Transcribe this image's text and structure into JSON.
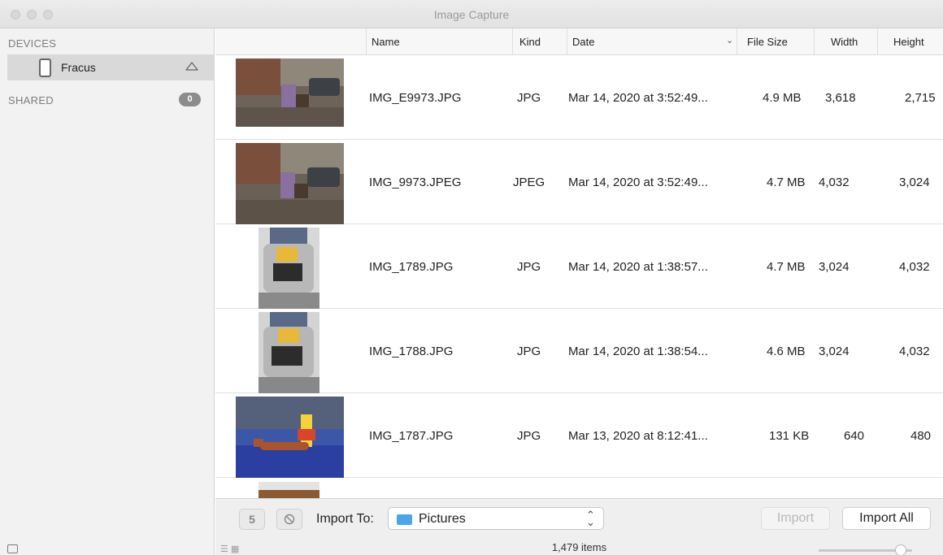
{
  "window": {
    "title": "Image Capture"
  },
  "sidebar": {
    "devices_header": "DEVICES",
    "device_name": "Fracus",
    "shared_header": "SHARED",
    "shared_count": "0"
  },
  "columns": {
    "name": "Name",
    "kind": "Kind",
    "date": "Date",
    "file_size": "File Size",
    "width": "Width",
    "height": "Height"
  },
  "rows": [
    {
      "name": "IMG_E9973.JPG",
      "kind": "JPG",
      "date": "Mar 14, 2020 at 3:52:49...",
      "size": "4.9 MB",
      "width": "3,618",
      "height": "2,715"
    },
    {
      "name": "IMG_9973.JPEG",
      "kind": "JPEG",
      "date": "Mar 14, 2020 at 3:52:49...",
      "size": "4.7 MB",
      "width": "4,032",
      "height": "3,024"
    },
    {
      "name": "IMG_1789.JPG",
      "kind": "JPG",
      "date": "Mar 14, 2020 at 1:38:57...",
      "size": "4.7 MB",
      "width": "3,024",
      "height": "4,032"
    },
    {
      "name": "IMG_1788.JPG",
      "kind": "JPG",
      "date": "Mar 14, 2020 at 1:38:54...",
      "size": "4.6 MB",
      "width": "3,024",
      "height": "4,032"
    },
    {
      "name": "IMG_1787.JPG",
      "kind": "JPG",
      "date": "Mar 13, 2020 at 8:12:41...",
      "size": "131 KB",
      "width": "640",
      "height": "480"
    }
  ],
  "bottombar": {
    "rotate_label": "5",
    "import_to_label": "Import To:",
    "destination": "Pictures",
    "import_button": "Import",
    "import_all_button": "Import All",
    "items_count": "1,479 items"
  }
}
